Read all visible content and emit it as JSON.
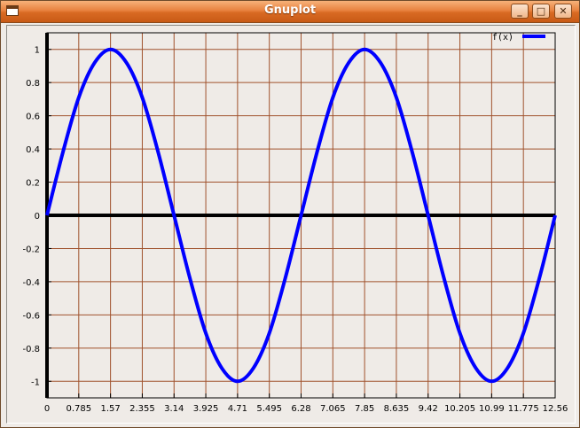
{
  "window": {
    "title": "Gnuplot",
    "minimize_icon": "minimize-icon",
    "maximize_icon": "maximize-icon",
    "close_icon": "close-icon",
    "minimize_glyph": "_",
    "maximize_glyph": "□",
    "close_glyph": "✕"
  },
  "colors": {
    "title_bar": "#e0782f",
    "grid": "#a0522d",
    "series": "#0000ff",
    "axis": "#000000",
    "background": "#efebe7"
  },
  "chart_data": {
    "type": "line",
    "title": "",
    "xlabel": "",
    "ylabel": "",
    "xlim": [
      0,
      12.56
    ],
    "ylim": [
      -1.1,
      1.1
    ],
    "grid": true,
    "legend_position": "top-right",
    "x_ticks": [
      "0",
      "0.785",
      "1.57",
      "2.355",
      "3.14",
      "3.925",
      "4.71",
      "5.495",
      "6.28",
      "7.065",
      "7.85",
      "8.635",
      "9.42",
      "10.205",
      "10.99",
      "11.775",
      "12.56"
    ],
    "y_ticks": [
      "-1",
      "-0.8",
      "-0.6",
      "-0.4",
      "-0.2",
      "0",
      "0.2",
      "0.4",
      "0.6",
      "0.8",
      "1"
    ],
    "series": [
      {
        "name": "f(x)",
        "x": [
          0,
          0.393,
          0.785,
          1.178,
          1.57,
          1.963,
          2.355,
          2.748,
          3.14,
          3.533,
          3.925,
          4.318,
          4.71,
          5.103,
          5.495,
          5.888,
          6.28,
          6.673,
          7.065,
          7.458,
          7.85,
          8.243,
          8.635,
          9.028,
          9.42,
          9.813,
          10.205,
          10.598,
          10.99,
          11.383,
          11.775,
          12.168,
          12.56
        ],
        "values": [
          0,
          0.38,
          0.71,
          0.92,
          1.0,
          0.92,
          0.71,
          0.38,
          0,
          -0.38,
          -0.71,
          -0.92,
          -1.0,
          -0.92,
          -0.71,
          -0.38,
          0,
          0.38,
          0.71,
          0.92,
          1.0,
          0.92,
          0.71,
          0.38,
          0,
          -0.38,
          -0.71,
          -0.92,
          -1.0,
          -0.92,
          -0.71,
          -0.38,
          0
        ]
      }
    ]
  }
}
